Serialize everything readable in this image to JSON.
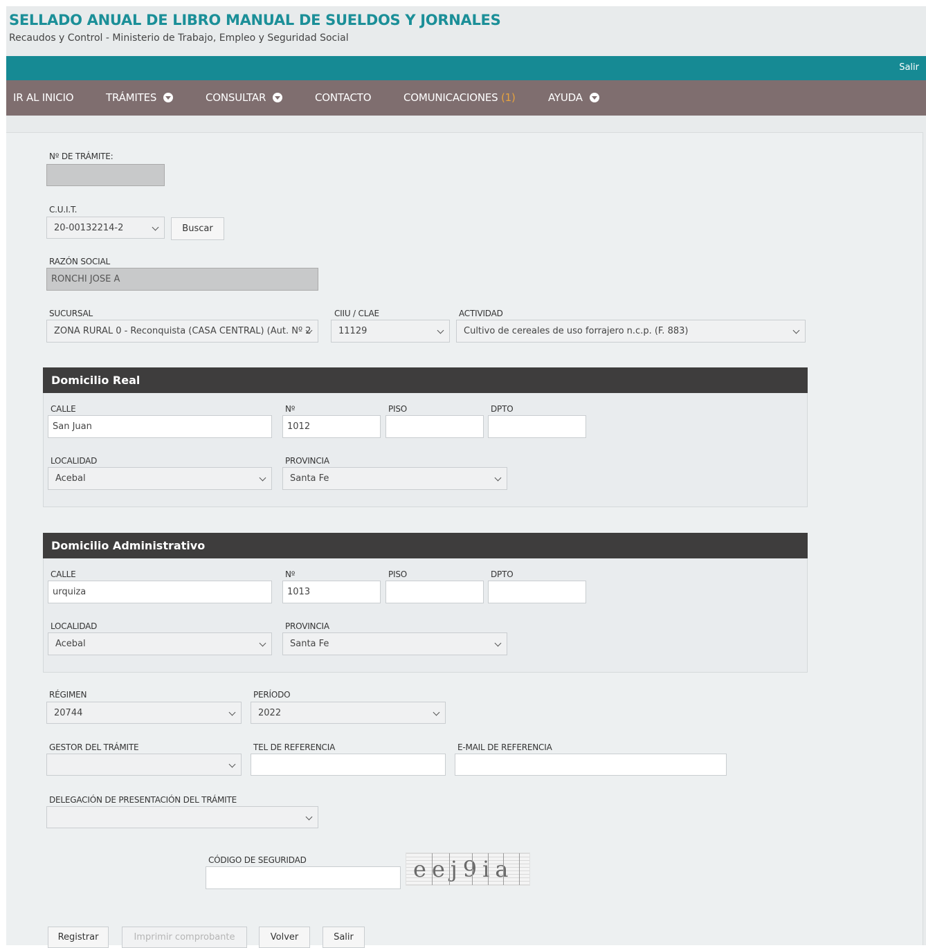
{
  "header": {
    "title": "SELLADO ANUAL DE LIBRO MANUAL DE SUELDOS Y JORNALES",
    "subtitle": "Recaudos y Control - Ministerio de Trabajo, Empleo y Seguridad Social",
    "exit_label": "Salir"
  },
  "nav": {
    "home": "IR AL INICIO",
    "tramites": "TRÁMITES",
    "consultar": "CONSULTAR",
    "contacto": "CONTACTO",
    "comunicaciones": "COMUNICACIONES",
    "comunicaciones_count": "(1)",
    "ayuda": "AYUDA"
  },
  "form": {
    "tramite_label": "Nº DE TRÁMITE:",
    "tramite_value": "",
    "cuit_label": "C.U.I.T.",
    "cuit_value": "20-00132214-2",
    "buscar_label": "Buscar",
    "razon_label": "RAZÓN SOCIAL",
    "razon_value": "RONCHI JOSE A",
    "sucursal_label": "SUCURSAL",
    "sucursal_value": "ZONA RURAL 0 - Reconquista (CASA CENTRAL) (Aut. Nº 2",
    "ciiu_label": "CIIU / CLAE",
    "ciiu_value": "11129",
    "actividad_label": "ACTIVIDAD",
    "actividad_value": "Cultivo de cereales de uso forrajero n.c.p. (F. 883)"
  },
  "domicilio_real": {
    "title": "Domicilio Real",
    "calle_label": "CALLE",
    "calle_value": "San Juan",
    "numero_label": "Nº",
    "numero_value": "1012",
    "piso_label": "PISO",
    "piso_value": "",
    "dpto_label": "DPTO",
    "dpto_value": "",
    "localidad_label": "LOCALIDAD",
    "localidad_value": "Acebal",
    "provincia_label": "PROVINCIA",
    "provincia_value": "Santa Fe"
  },
  "domicilio_admin": {
    "title": "Domicilio Administrativo",
    "calle_label": "CALLE",
    "calle_value": "urquiza",
    "numero_label": "Nº",
    "numero_value": "1013",
    "piso_label": "PISO",
    "piso_value": "",
    "dpto_label": "DPTO",
    "dpto_value": "",
    "localidad_label": "LOCALIDAD",
    "localidad_value": "Acebal",
    "provincia_label": "PROVINCIA",
    "provincia_value": "Santa Fe"
  },
  "extra": {
    "regimen_label": "RÉGIMEN",
    "regimen_value": "20744",
    "periodo_label": "PERÍODO",
    "periodo_value": "2022",
    "gestor_label": "GESTOR DEL TRÁMITE",
    "gestor_value": "",
    "tel_label": "TEL DE REFERENCIA",
    "tel_value": "",
    "email_label": "E-MAIL DE REFERENCIA",
    "email_value": "",
    "delegacion_label": "DELEGACIÓN DE PRESENTACIÓN DEL TRÁMITE",
    "delegacion_value": "",
    "codigo_label": "CÓDIGO DE SEGURIDAD",
    "codigo_value": "",
    "captcha_text": "eej9ia"
  },
  "actions": {
    "registrar": "Registrar",
    "imprimir": "Imprimir comprobante",
    "volver": "Volver",
    "salir": "Salir"
  }
}
